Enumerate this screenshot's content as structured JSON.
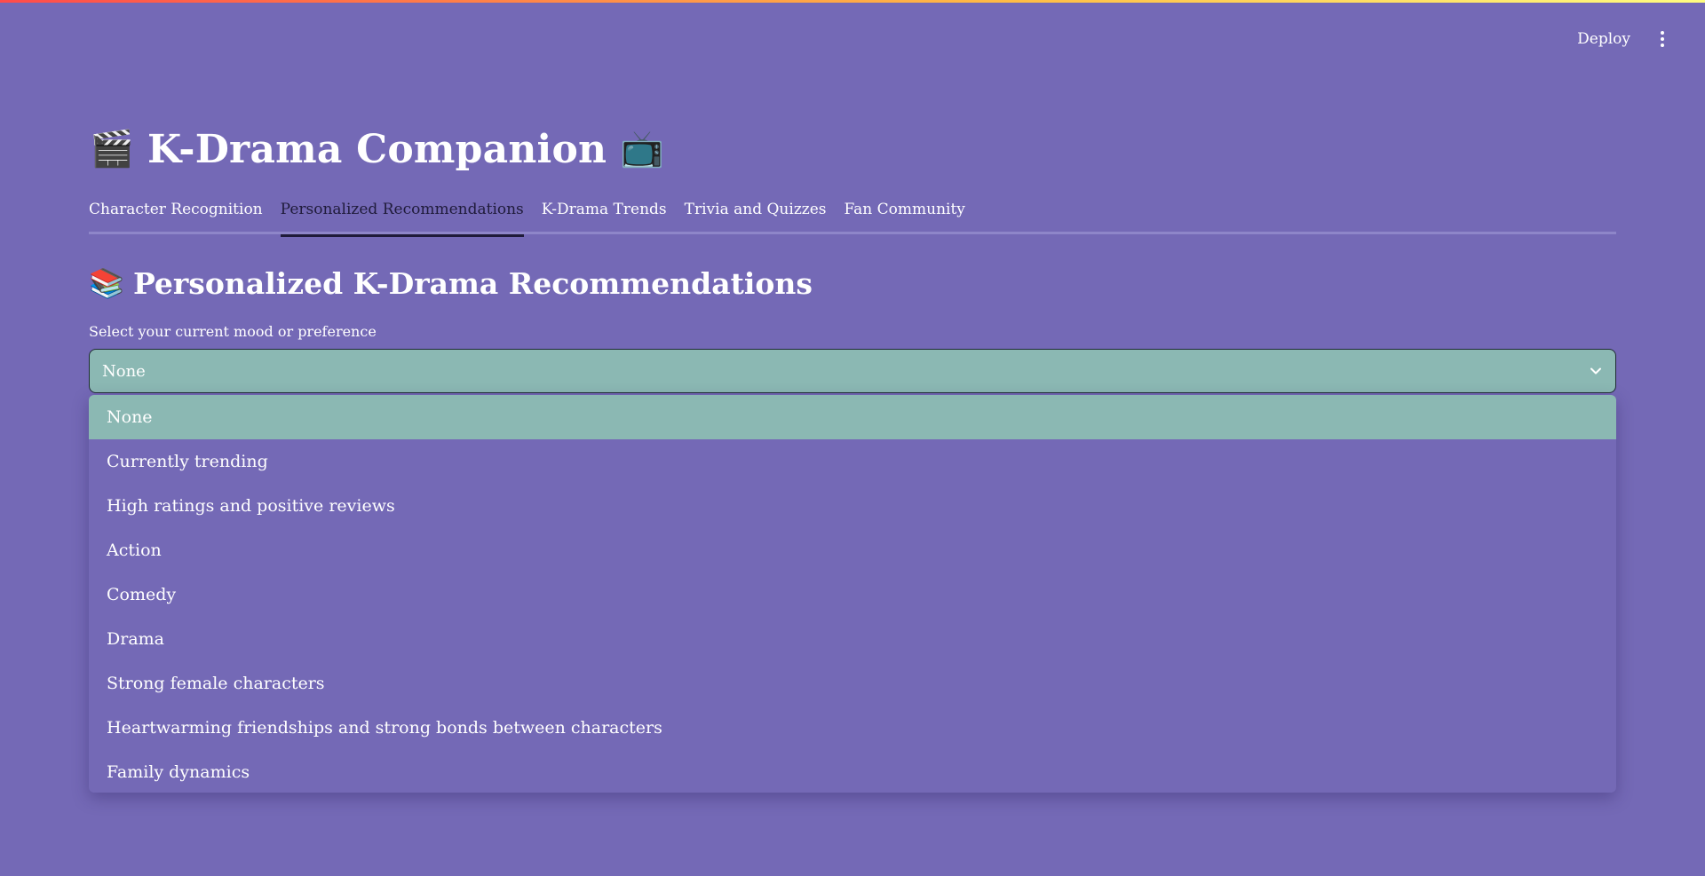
{
  "header": {
    "deploy_label": "Deploy",
    "menu_icon": "more-vertical-icon"
  },
  "app": {
    "title": "K-Drama Companion",
    "title_emoji_left": "🎬",
    "title_emoji_right": "📺"
  },
  "tabs": [
    {
      "label": "Character Recognition",
      "active": false
    },
    {
      "label": "Personalized Recommendations",
      "active": true
    },
    {
      "label": "K-Drama Trends",
      "active": false
    },
    {
      "label": "Trivia and Quizzes",
      "active": false
    },
    {
      "label": "Fan Community",
      "active": false
    }
  ],
  "section": {
    "emoji": "📚",
    "title": "Personalized K-Drama Recommendations"
  },
  "select": {
    "label": "Select your current mood or preference",
    "value": "None",
    "options": [
      "None",
      "Currently trending",
      "High ratings and positive reviews",
      "Action",
      "Comedy",
      "Drama",
      "Strong female characters",
      "Heartwarming friendships and strong bonds between characters",
      "Family dynamics"
    ]
  },
  "colors": {
    "background": "#7469b6",
    "select_fill": "#8bb8b3",
    "active_tab": "#1f1b3a"
  }
}
